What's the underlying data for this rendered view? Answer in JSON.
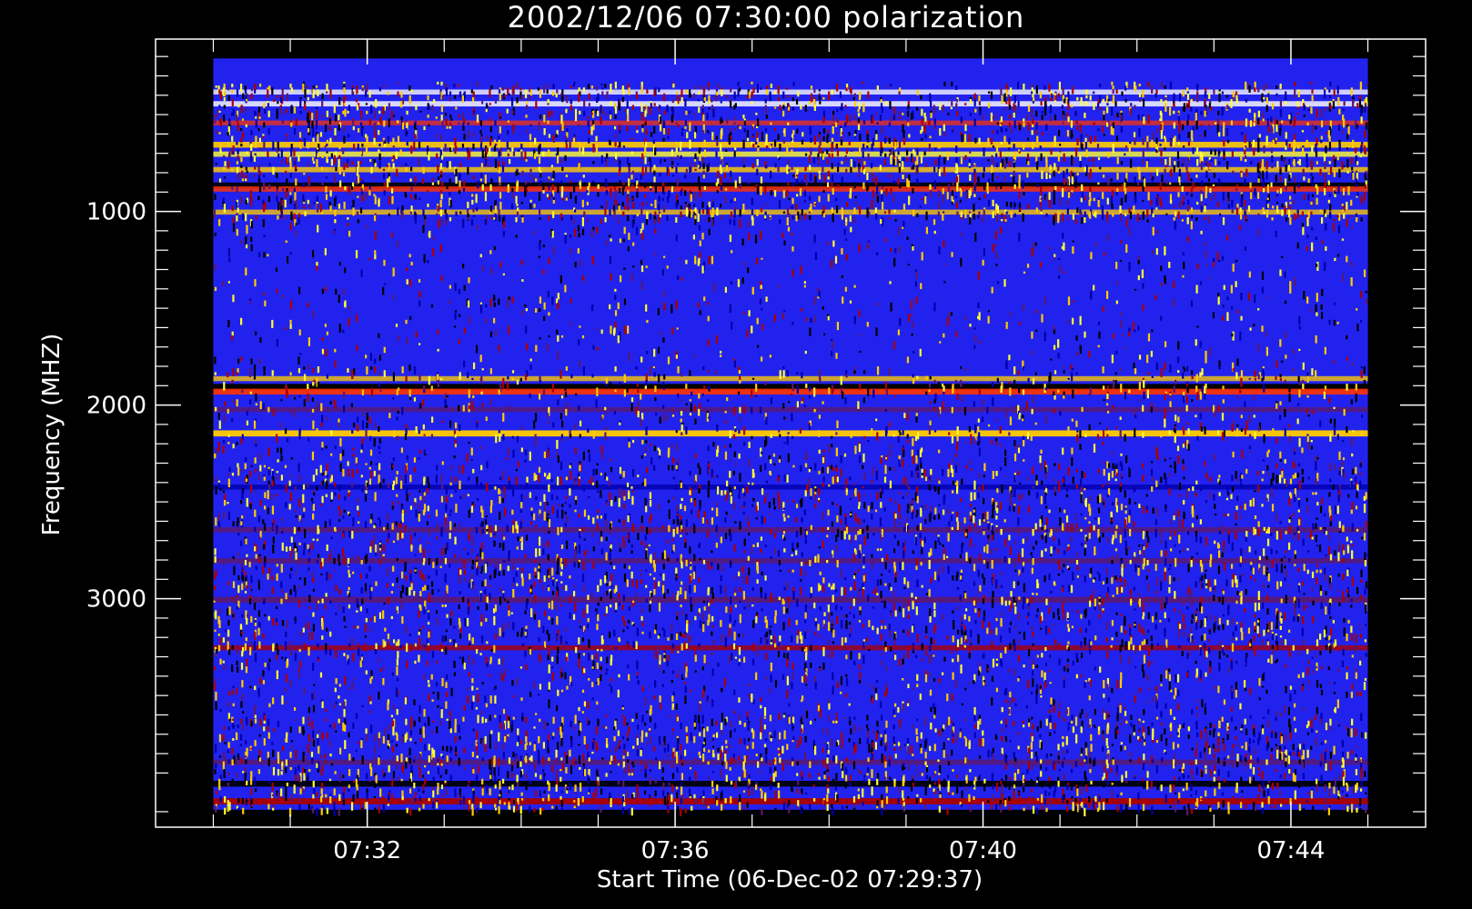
{
  "chart_data": {
    "type": "heatmap",
    "title": "2002/12/06 07:30:00 polarization",
    "xlabel": "Start Time (06-Dec-02 07:29:37)",
    "ylabel": "Frequency (MHZ)",
    "x_ticks": [
      {
        "value": 2.0,
        "label": "07:32"
      },
      {
        "value": 6.0,
        "label": "07:36"
      },
      {
        "value": 10.0,
        "label": "07:40"
      },
      {
        "value": 14.0,
        "label": "07:44"
      }
    ],
    "y_ticks": [
      {
        "value": 1000,
        "label": "1000"
      },
      {
        "value": 2000,
        "label": "2000"
      },
      {
        "value": 3000,
        "label": "3000"
      }
    ],
    "x_range_minutes": [
      -0.75,
      15.75
    ],
    "y_range_mhz": [
      110,
      4180
    ],
    "data_x_range_minutes": [
      0.0,
      15.0
    ],
    "data_y_range_mhz": [
      210,
      4090
    ],
    "background_color": "#2222ee",
    "palette": [
      "#2222ee",
      "#0000aa",
      "#000000",
      "#5a1870",
      "#aa0000",
      "#ff3300",
      "#ffcc00",
      "#ffff33",
      "#ffffff"
    ],
    "bands_mhz": [
      {
        "f": 380,
        "color": "#ffffff",
        "intensity": 0.5
      },
      {
        "f": 440,
        "color": "#ffffff",
        "intensity": 0.6
      },
      {
        "f": 540,
        "color": "#ff3300",
        "intensity": 0.4
      },
      {
        "f": 650,
        "color": "#ffcc00",
        "intensity": 0.8
      },
      {
        "f": 700,
        "color": "#ffff33",
        "intensity": 0.6
      },
      {
        "f": 780,
        "color": "#ffcc00",
        "intensity": 0.6
      },
      {
        "f": 860,
        "color": "#000000",
        "intensity": 0.8
      },
      {
        "f": 880,
        "color": "#ff3300",
        "intensity": 0.6
      },
      {
        "f": 1000,
        "color": "#ffcc00",
        "intensity": 0.5
      },
      {
        "f": 1900,
        "color": "#000000",
        "intensity": 1.0
      },
      {
        "f": 1925,
        "color": "#ff3300",
        "intensity": 0.8
      },
      {
        "f": 1860,
        "color": "#ffcc00",
        "intensity": 0.5
      },
      {
        "f": 2020,
        "color": "#5a1870",
        "intensity": 0.5
      },
      {
        "f": 2140,
        "color": "#ffcc00",
        "intensity": 0.9
      },
      {
        "f": 2420,
        "color": "#0000aa",
        "intensity": 0.5
      },
      {
        "f": 2640,
        "color": "#5a1870",
        "intensity": 0.6
      },
      {
        "f": 2800,
        "color": "#5a1870",
        "intensity": 0.6
      },
      {
        "f": 3000,
        "color": "#5a1870",
        "intensity": 0.8
      },
      {
        "f": 3250,
        "color": "#aa0000",
        "intensity": 0.5
      },
      {
        "f": 3840,
        "color": "#5a1870",
        "intensity": 0.6
      },
      {
        "f": 3950,
        "color": "#000000",
        "intensity": 0.8
      },
      {
        "f": 4040,
        "color": "#aa0000",
        "intensity": 0.9
      }
    ]
  }
}
